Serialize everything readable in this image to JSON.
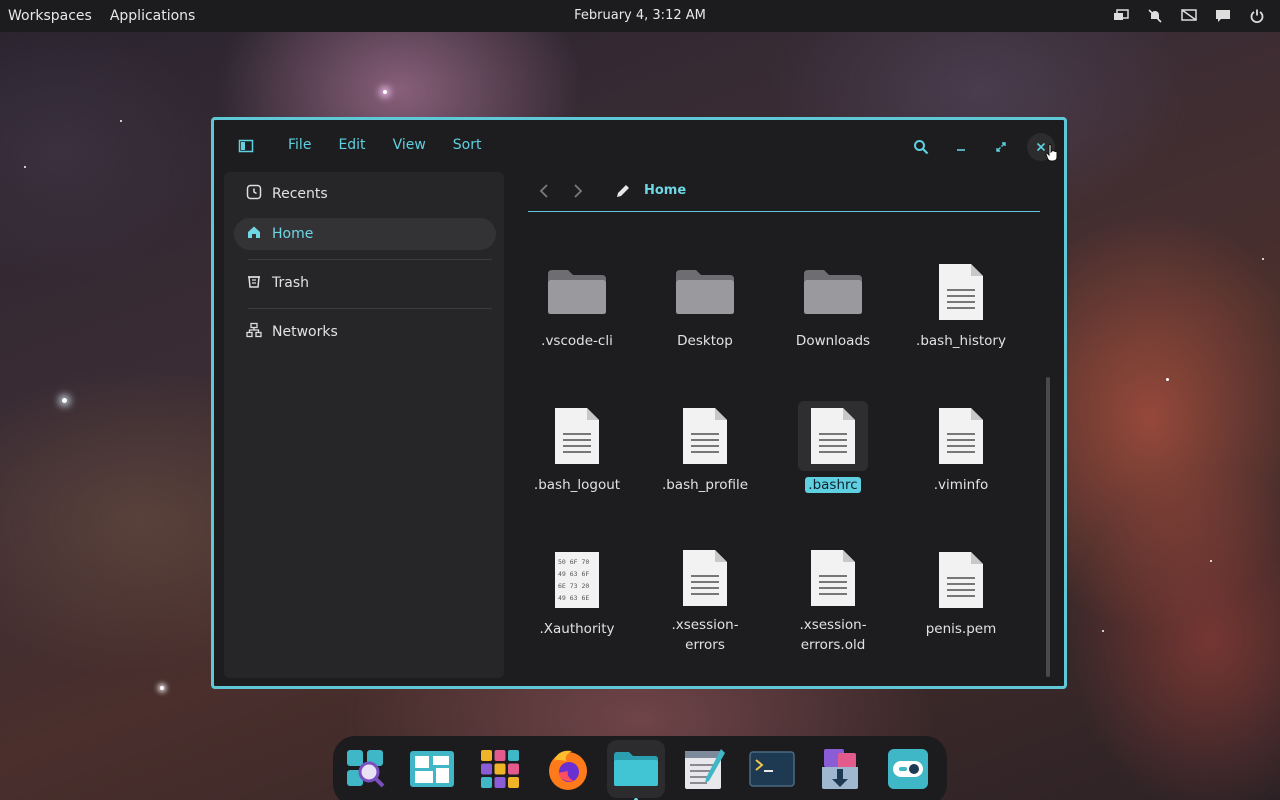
{
  "topbar": {
    "menu": [
      "Workspaces",
      "Applications"
    ],
    "clock": "February 4, 3:12 AM",
    "tray_icons": [
      "display-icon",
      "notifications-off-icon",
      "screen-icon",
      "chat-icon",
      "power-icon"
    ]
  },
  "window": {
    "menu": [
      "File",
      "Edit",
      "View",
      "Sort"
    ],
    "sidebar": {
      "items": [
        {
          "label": "Recents",
          "icon": "recents-icon"
        },
        {
          "label": "Home",
          "icon": "home-icon",
          "active": true
        },
        {
          "label": "Trash",
          "icon": "trash-icon"
        },
        {
          "label": "Networks",
          "icon": "network-icon"
        }
      ]
    },
    "pathbar": {
      "current": "Home"
    },
    "files": [
      {
        "name": ".vscode-cli",
        "type": "folder"
      },
      {
        "name": "Desktop",
        "type": "folder"
      },
      {
        "name": "Downloads",
        "type": "folder"
      },
      {
        "name": ".bash_history",
        "type": "text"
      },
      {
        "name": ".bash_logout",
        "type": "text"
      },
      {
        "name": ".bash_profile",
        "type": "text"
      },
      {
        "name": ".bashrc",
        "type": "text",
        "selected": true
      },
      {
        "name": ".viminfo",
        "type": "text"
      },
      {
        "name": ".Xauthority",
        "type": "binary"
      },
      {
        "name": ".xsession-errors",
        "type": "text"
      },
      {
        "name": ".xsession-errors.old",
        "type": "text"
      },
      {
        "name": "penis.pem",
        "type": "text"
      }
    ],
    "binary_hex": [
      "50 6F 70",
      "49 63 6F",
      "6E 73 20",
      "49 63 6E"
    ]
  },
  "dock": {
    "apps": [
      "search-app-icon",
      "workspaces-app-icon",
      "app-grid-icon",
      "firefox-icon",
      "files-icon",
      "text-editor-icon",
      "terminal-icon",
      "installer-icon",
      "settings-toggle-icon"
    ]
  },
  "colors": {
    "accent": "#5fc8d6",
    "panel": "#1c1c1e",
    "window": "#1d1d1f",
    "sidebar": "#262628"
  }
}
